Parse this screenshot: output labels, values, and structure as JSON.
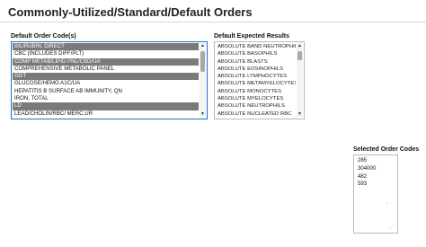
{
  "page": {
    "title": "Commonly-Utilized/Standard/Default Orders"
  },
  "order_codes": {
    "label": "Default Order Code(s)",
    "items": [
      {
        "text": "BILIRUBIN, DIRECT",
        "selected": true
      },
      {
        "text": "CBC (INCLUDES DIFF/PLT)",
        "selected": false
      },
      {
        "text": "COMP METAB/LIPID PNL/CBD/UA",
        "selected": true
      },
      {
        "text": "COMPREHENSIVE METABOLIC PANEL",
        "selected": false
      },
      {
        "text": "GGT",
        "selected": true
      },
      {
        "text": "GLUCOSE/HEMO A1C/UA",
        "selected": false
      },
      {
        "text": "HEPATITIS B SURFACE AB IMMUNITY, QN",
        "selected": false
      },
      {
        "text": "IRON, TOTAL",
        "selected": false
      },
      {
        "text": "LD",
        "selected": true
      },
      {
        "text": "LEAD/CHOLIN/RBC/ MERC,UR",
        "selected": false
      }
    ]
  },
  "expected_results": {
    "label": "Default Expected Results",
    "items": [
      "ABSOLUTE BAND NEUTROPHILS",
      "ABSOLUTE BASOPHILS",
      "ABSOLUTE BLASTS",
      "ABSOLUTE EOSINOPHILS",
      "ABSOLUTE LYMPHOCYTES",
      "ABSOLUTE METAMYELOCYTES",
      "ABSOLUTE MONOCYTES",
      "ABSOLUTE MYELOCYTES",
      "ABSOLUTE NEUTROPHILS",
      "ABSOLUTE NUCLEATED RBC"
    ]
  },
  "selected_codes": {
    "label": "Selected Order Codes",
    "items": [
      "285",
      "304000",
      "482",
      "593"
    ]
  },
  "colors": {
    "selected_row": "#7a7a7a",
    "focus_border": "#1f6fd1"
  }
}
